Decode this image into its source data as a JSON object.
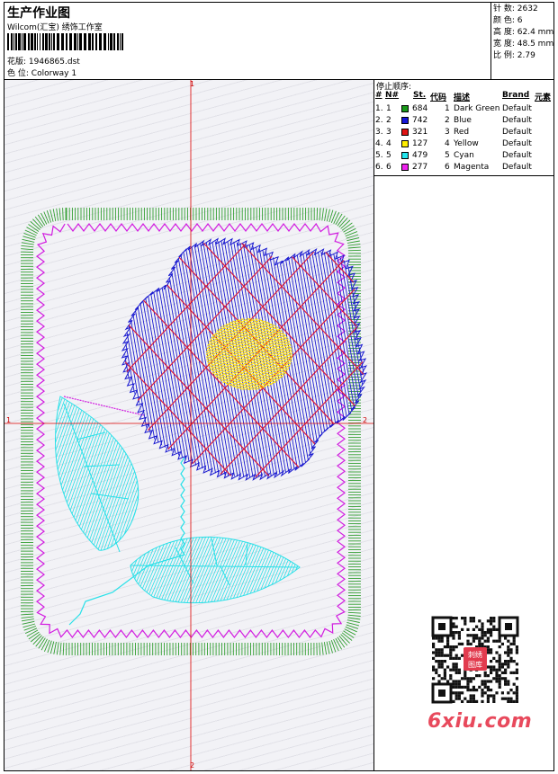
{
  "header": {
    "title": "生产作业图",
    "company": "Wilcom(汇宝) 绣饰工作室",
    "design_label": "花版:",
    "design_value": "1946865.dst",
    "colorway_label": "色 位:",
    "colorway_value": "Colorway 1"
  },
  "stats": [
    {
      "label": "针 数:",
      "value": "2632"
    },
    {
      "label": "颜 色:",
      "value": "6"
    },
    {
      "label": "高 度:",
      "value": "62.4 mm"
    },
    {
      "label": "宽 度:",
      "value": "48.5 mm"
    },
    {
      "label": "比 例:",
      "value": "2.79"
    }
  ],
  "sequence": {
    "title": "停止顺序:",
    "headers": {
      "num": "#",
      "n": "N#",
      "st": "St.",
      "code": "代码",
      "desc": "描述",
      "brand": "Brand",
      "element": "元素"
    },
    "rows": [
      {
        "num": "1.",
        "n": "1",
        "color": "#1a9a1a",
        "st": "684",
        "code": "1",
        "desc": "Dark Green",
        "brand": "Default"
      },
      {
        "num": "2.",
        "n": "2",
        "color": "#1616d8",
        "st": "742",
        "code": "2",
        "desc": "Blue",
        "brand": "Default"
      },
      {
        "num": "3.",
        "n": "3",
        "color": "#e01414",
        "st": "321",
        "code": "3",
        "desc": "Red",
        "brand": "Default"
      },
      {
        "num": "4.",
        "n": "4",
        "color": "#ffee00",
        "st": "127",
        "code": "4",
        "desc": "Yellow",
        "brand": "Default"
      },
      {
        "num": "5.",
        "n": "5",
        "color": "#22e6ee",
        "st": "479",
        "code": "5",
        "desc": "Cyan",
        "brand": "Default"
      },
      {
        "num": "6.",
        "n": "6",
        "color": "#ee22ee",
        "st": "277",
        "code": "6",
        "desc": "Magenta",
        "brand": "Default"
      }
    ]
  },
  "canvas": {
    "axis_labels": {
      "top": "1",
      "right": "2",
      "bottom": "2",
      "left": "1"
    },
    "colors": {
      "green": "#2f9e2f",
      "blue": "#1a1ad0",
      "red": "#d81a3a",
      "yellow": "#ffe000",
      "cyan": "#28e0e8",
      "magenta": "#d21ee0",
      "axis": "#dd0000"
    }
  },
  "watermark": {
    "text": "6xiu.com",
    "qr_badge": "刺绣图库"
  }
}
